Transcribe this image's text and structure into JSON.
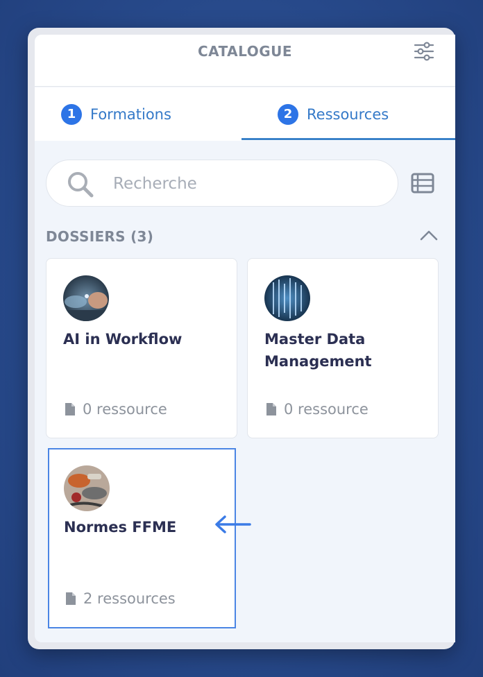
{
  "header": {
    "title": "CATALOGUE"
  },
  "tabs": [
    {
      "number": "1",
      "label": "Formations"
    },
    {
      "number": "2",
      "label": "Ressources"
    }
  ],
  "search": {
    "placeholder": "Recherche"
  },
  "section": {
    "title": "DOSSIERS (3)"
  },
  "folders": [
    {
      "title": "AI in Workflow",
      "count": "0 ressource"
    },
    {
      "title": "Master Data Management",
      "count": "0 ressource"
    },
    {
      "title": "Normes FFME",
      "count": "2 ressources"
    }
  ],
  "colors": {
    "accent": "#2d74e6",
    "tab_text": "#3479c8",
    "card_title": "#2b2f52",
    "muted": "#8d939c"
  }
}
